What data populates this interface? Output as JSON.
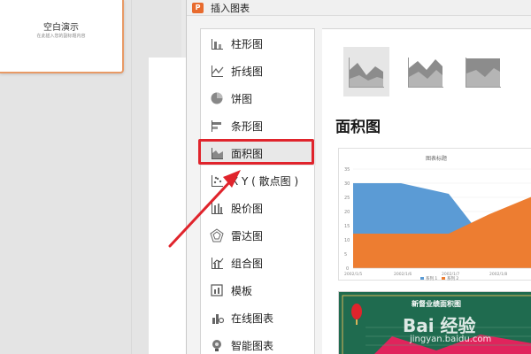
{
  "slide_thumb": {
    "title": "空白演示",
    "subtitle": "在此插入您的副标题内容"
  },
  "dialog": {
    "app_icon": "P",
    "title": "插入图表",
    "nav_items": [
      {
        "label": "柱形图",
        "icon": "column-chart-icon"
      },
      {
        "label": "折线图",
        "icon": "line-chart-icon"
      },
      {
        "label": "饼图",
        "icon": "pie-chart-icon"
      },
      {
        "label": "条形图",
        "icon": "bar-chart-icon"
      },
      {
        "label": "面积图",
        "icon": "area-chart-icon",
        "selected": true
      },
      {
        "label": "X Y ( 散点图 )",
        "icon": "scatter-chart-icon"
      },
      {
        "label": "股价图",
        "icon": "stock-chart-icon"
      },
      {
        "label": "雷达图",
        "icon": "radar-chart-icon"
      },
      {
        "label": "组合图",
        "icon": "combo-chart-icon"
      },
      {
        "label": "模板",
        "icon": "template-icon"
      },
      {
        "label": "在线图表",
        "icon": "online-chart-icon"
      },
      {
        "label": "智能图表",
        "icon": "smart-chart-icon"
      }
    ],
    "section_title": "面积图",
    "preview1": {
      "title": "图表标题",
      "y_ticks": [
        "35",
        "30",
        "25",
        "20",
        "15",
        "10",
        "5",
        "0"
      ],
      "x_ticks": [
        "2002/1/5",
        "2002/1/6",
        "2002/1/7",
        "2002/1/8"
      ],
      "legend": [
        "系列 1",
        "系列 2"
      ]
    },
    "preview2": {
      "title": "新督业绩面积图"
    }
  },
  "colors": {
    "series1": "#5b9bd5",
    "series2": "#ed7d31",
    "highlight": "#e0242c",
    "accent": "#e86b2e"
  },
  "watermark": {
    "brand": "Bai 经验",
    "url": "jingyan.baidu.com"
  }
}
